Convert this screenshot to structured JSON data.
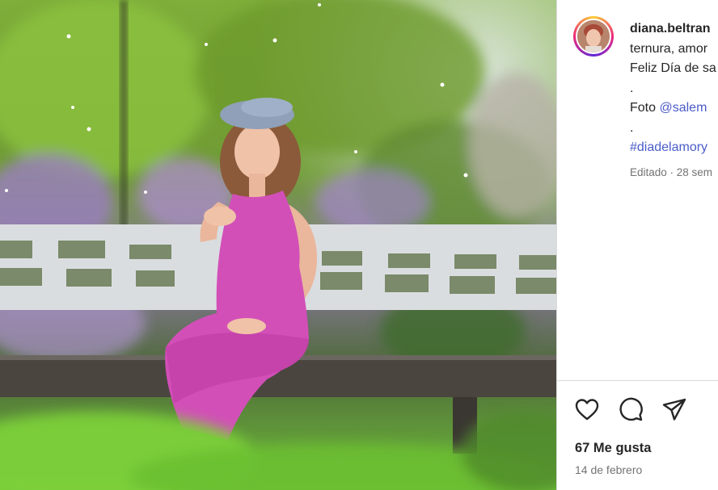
{
  "post": {
    "username": "diana.beltran",
    "caption_lines": [
      "ternura, amor",
      "Feliz Día de sa",
      "."
    ],
    "photo_credit_prefix": "Foto ",
    "photo_credit_mention": "@salem",
    "caption_dot": ".",
    "hashtag": "#diadelamory",
    "edited_meta": "Editado · 28 sem",
    "likes": "67 Me gusta",
    "date": "14 de febrero"
  },
  "icons": {
    "like": "heart-icon",
    "comment": "comment-icon",
    "share": "share-icon"
  },
  "colors": {
    "text": "#262626",
    "secondary": "#737373",
    "link": "#4a5cc9",
    "dress": "#d24fb8"
  }
}
